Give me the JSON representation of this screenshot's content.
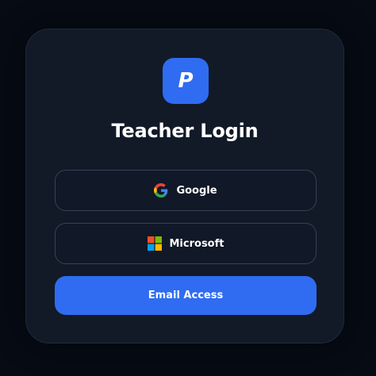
{
  "app": {
    "logo_letter": "P",
    "title": "Teacher Login"
  },
  "auth": {
    "google_label": "Google",
    "microsoft_label": "Microsoft",
    "email_label": "Email Access"
  },
  "icons": {
    "google": "google-g-icon",
    "microsoft": "microsoft-logo-icon"
  },
  "colors": {
    "background": "#060b14",
    "card": "#121a28",
    "accent": "#2f6cf1",
    "button_border": "#384254",
    "text": "#ffffff"
  }
}
